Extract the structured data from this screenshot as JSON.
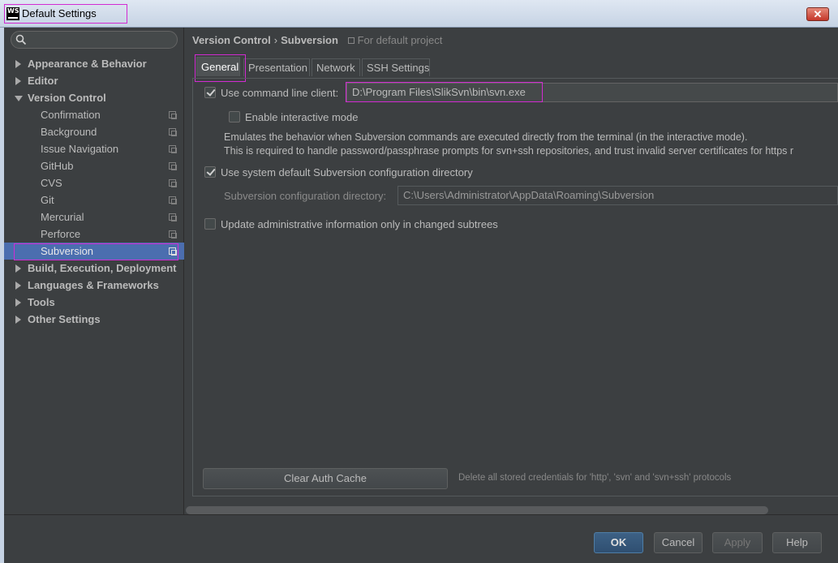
{
  "window": {
    "title": "Default Settings",
    "close_glyph": "✕"
  },
  "search": {
    "placeholder": "",
    "icon": "search-icon"
  },
  "sidebar": {
    "items": [
      {
        "label": "Appearance & Behavior",
        "level": 0,
        "expanded": false
      },
      {
        "label": "Editor",
        "level": 0,
        "expanded": false
      },
      {
        "label": "Version Control",
        "level": 0,
        "expanded": true
      },
      {
        "label": "Confirmation",
        "level": 1
      },
      {
        "label": "Background",
        "level": 1
      },
      {
        "label": "Issue Navigation",
        "level": 1
      },
      {
        "label": "GitHub",
        "level": 1
      },
      {
        "label": "CVS",
        "level": 1
      },
      {
        "label": "Git",
        "level": 1
      },
      {
        "label": "Mercurial",
        "level": 1
      },
      {
        "label": "Perforce",
        "level": 1
      },
      {
        "label": "Subversion",
        "level": 1,
        "selected": true
      },
      {
        "label": "Build, Execution, Deployment",
        "level": 0,
        "expanded": false
      },
      {
        "label": "Languages & Frameworks",
        "level": 0,
        "expanded": false
      },
      {
        "label": "Tools",
        "level": 0,
        "expanded": false
      },
      {
        "label": "Other Settings",
        "level": 0,
        "expanded": false
      }
    ]
  },
  "breadcrumb": {
    "parent": "Version Control",
    "separator": "›",
    "current": "Subversion",
    "scope": "For default project"
  },
  "tabs": [
    {
      "label": "General",
      "active": true
    },
    {
      "label": "Presentation",
      "active": false
    },
    {
      "label": "Network",
      "active": false
    },
    {
      "label": "SSH Settings",
      "active": false
    }
  ],
  "general": {
    "cmd_client": {
      "label": "Use command line client:",
      "checked": true,
      "value": "D:\\Program Files\\SlikSvn\\bin\\svn.exe"
    },
    "interactive": {
      "label": "Enable interactive mode",
      "checked": false
    },
    "desc_line1": "Emulates the behavior when Subversion commands are executed directly from the terminal (in the interactive mode).",
    "desc_line2": "This is required to handle password/passphrase prompts for svn+ssh repositories, and trust invalid server certificates for https r",
    "system_config": {
      "label": "Use system default Subversion configuration directory",
      "checked": true
    },
    "config_dir": {
      "label": "Subversion configuration directory:",
      "value": "C:\\Users\\Administrator\\AppData\\Roaming\\Subversion"
    },
    "update_admin": {
      "label": "Update administrative information only in changed subtrees",
      "checked": false
    },
    "clear_cache": {
      "label": "Clear Auth Cache",
      "hint": "Delete all stored credentials for 'http', 'svn' and 'svn+ssh' protocols"
    }
  },
  "footer": {
    "ok": "OK",
    "cancel": "Cancel",
    "apply": "Apply",
    "help": "Help"
  },
  "colors": {
    "selection": "#4b6eaf",
    "annotation": "#d22bd2",
    "background": "#3c3f41"
  }
}
